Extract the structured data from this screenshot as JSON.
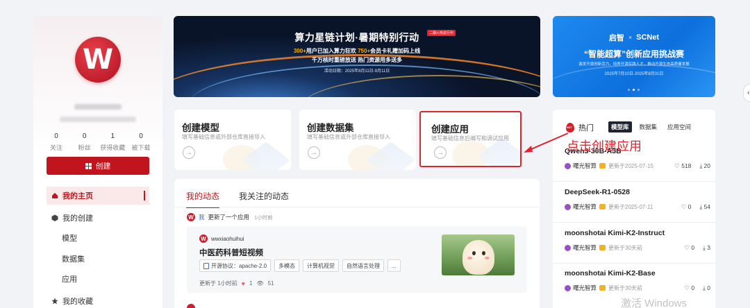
{
  "profile": {
    "avatar_letter": "W",
    "stats": [
      {
        "value": "0",
        "label": "关注"
      },
      {
        "value": "0",
        "label": "粉丝"
      },
      {
        "value": "1",
        "label": "获得收藏"
      },
      {
        "value": "0",
        "label": "被下载"
      }
    ]
  },
  "sidebar": {
    "create_label": "创建",
    "items": [
      {
        "label": "我的主页"
      },
      {
        "label": "我的创建"
      },
      {
        "label": "模型"
      },
      {
        "label": "数据集"
      },
      {
        "label": "应用"
      },
      {
        "label": "我的收藏"
      }
    ]
  },
  "banner_main": {
    "title": "算力星链计划·暑期特别行动",
    "tag": "二期火热进行中",
    "line1_prefix": "300+",
    "line1_mid": "用户已加入算力狂欢 ",
    "line1_hl": "750+",
    "line1_suffix": "会员卡礼赠加码上线",
    "line2": "千万核时重磅放送 热门资源用多送多",
    "date": "活动日期：2025年8月11日-9月11日"
  },
  "banner_side": {
    "logo1": "启智",
    "x": "×",
    "logo2": "SCNet",
    "title": "“智能超算”创新应用挑战赛",
    "subtitle": "激发开源创新活力，培养开源实践人才，推动开源生态高质量发展",
    "date": "2025年7月10日-2025年8月31日"
  },
  "cards": [
    {
      "title": "创建模型",
      "desc": "填写基础信息或外部仓库直接导入"
    },
    {
      "title": "创建数据集",
      "desc": "填写基础信息或外部仓库直接导入"
    },
    {
      "title": "创建应用",
      "desc": "填写基础信息后编写和调试应用"
    }
  ],
  "feed": {
    "tabs": [
      "我的动态",
      "我关注的动态"
    ],
    "activity": {
      "me": "我",
      "action": "更新了一个应用",
      "time": "1小时前"
    },
    "app": {
      "user": "wwxiaohuihui",
      "title": "中医药科普短视频",
      "tags": [
        "开源协议：apache-2.0",
        "多模态",
        "计算机视觉",
        "自然语言处理",
        "..."
      ],
      "updated": "更新于 1小时前",
      "likes": "1",
      "views": "51"
    }
  },
  "hot": {
    "title": "热门",
    "tabs": [
      "模型库",
      "数据集",
      "应用空间"
    ],
    "items": [
      {
        "name": "Qwen3-30B-A3B",
        "org": "曙光智算",
        "updated": "更新于2025-07-15",
        "likes": "518",
        "downloads": "20"
      },
      {
        "name": "DeepSeek-R1-0528",
        "org": "曙光智算",
        "updated": "更新于2025-07-11",
        "likes": "0",
        "downloads": "54"
      },
      {
        "name": "moonshotai Kimi-K2-Instruct",
        "org": "曙光智算",
        "updated": "更新于30天前",
        "likes": "0",
        "downloads": "3"
      },
      {
        "name": "moonshotai Kimi-K2-Base",
        "org": "曙光智算",
        "updated": "更新于30天前",
        "likes": "0",
        "downloads": "0"
      }
    ]
  },
  "annotation": "点击创建应用",
  "watermark": "激活 Windows",
  "colors": {
    "brand": "#c0141e",
    "highlight_box": "#e0242e",
    "banner_side": "#1e8af0"
  }
}
